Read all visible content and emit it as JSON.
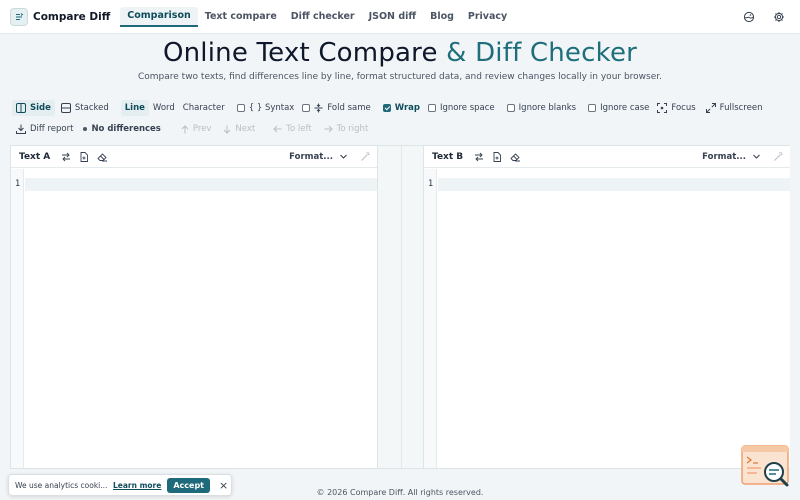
{
  "nav": {
    "brand": "Compare Diff",
    "links": [
      {
        "label": "Comparison",
        "active": true
      },
      {
        "label": "Text compare",
        "active": false
      },
      {
        "label": "Diff checker",
        "active": false
      },
      {
        "label": "JSON diff",
        "active": false
      },
      {
        "label": "Blog",
        "active": false
      },
      {
        "label": "Privacy",
        "active": false
      }
    ],
    "icons": [
      "theme-icon",
      "settings-gear-icon"
    ]
  },
  "hero": {
    "title_main": "Online Text Compare",
    "title_accent": " & Diff Checker",
    "subtitle": "Compare two texts, find differences line by line, format structured data, and review changes locally in your browser."
  },
  "toolbar": {
    "side": "Side",
    "stacked": "Stacked",
    "line": "Line",
    "word": "Word",
    "character": "Character",
    "syntax": "{ } Syntax",
    "fold_same": "Fold same",
    "wrap": "Wrap",
    "ignore_space": "Ignore space",
    "ignore_blanks": "Ignore blanks",
    "ignore_case": "Ignore case",
    "focus": "Focus",
    "fullscreen": "Fullscreen"
  },
  "toolbar2": {
    "diff_report": "Diff report",
    "status": "No differences",
    "prev": "Prev",
    "next": "Next",
    "to_left": "To left",
    "to_right": "To right"
  },
  "panels": {
    "a": {
      "label": "Text A",
      "format": "Format...",
      "line": "1"
    },
    "b": {
      "label": "Text B",
      "format": "Format...",
      "line": "1"
    }
  },
  "footer": {
    "text": "© 2026 Compare Diff. All rights reserved."
  },
  "cookie": {
    "text": "We use analytics cooki...",
    "learn_more": "Learn more",
    "accept": "Accept",
    "close": "×"
  },
  "colors": {
    "accent": "#1e6a7a",
    "accent_text": "#1e6f7b",
    "background": "#f1f5f7"
  }
}
